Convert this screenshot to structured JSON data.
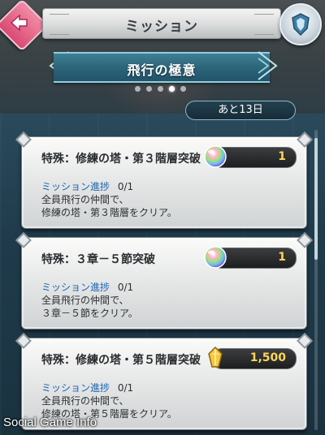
{
  "header": {
    "title": "ミッション",
    "back_icon": "back-arrow-icon",
    "menu_icon": "shield-icon"
  },
  "subheader": {
    "title": "飛行の極意",
    "page_count": 5,
    "active_page": 3
  },
  "remaining_label": "あと13日",
  "missions": [
    {
      "title": "特殊：修練の塔・第３階層突破",
      "reward_icon": "orb-icon",
      "reward_value": "1",
      "progress_label": "ミッション進捗",
      "progress_value": "0/1",
      "desc_line1": "全員飛行の仲間で、",
      "desc_line2": "修練の塔・第３階層をクリア。"
    },
    {
      "title": "特殊：３章－５節突破",
      "reward_icon": "orb-icon",
      "reward_value": "1",
      "progress_label": "ミッション進捗",
      "progress_value": "0/1",
      "desc_line1": "全員飛行の仲間で、",
      "desc_line2": "３章－５節をクリア。"
    },
    {
      "title": "特殊：修練の塔・第５階層突破",
      "reward_icon": "feather-crystal-icon",
      "reward_value": "1,500",
      "progress_label": "ミッション進捗",
      "progress_value": "0/1",
      "desc_line1": "全員飛行の仲間で、",
      "desc_line2": "修練の塔・第５階層をクリア。"
    }
  ],
  "watermark": "Social Game Info",
  "colors": {
    "accent_pink": "#d94a73",
    "ribbon_teal": "#2b6378",
    "reward_gold": "#ffd65a",
    "progress_blue": "#1a63b0"
  }
}
